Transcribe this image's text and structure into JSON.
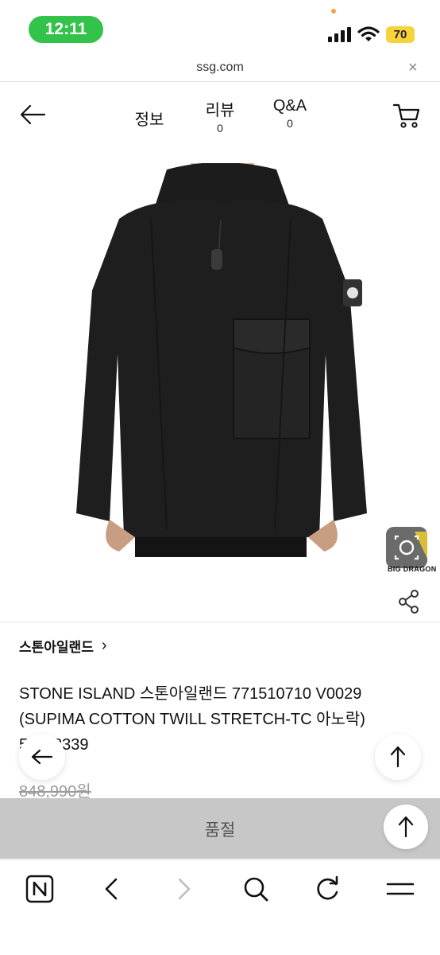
{
  "status_bar": {
    "time": "12:11",
    "battery": "70"
  },
  "browser": {
    "url": "ssg.com",
    "close_glyph": "×"
  },
  "header": {
    "tabs": [
      {
        "label": "정보"
      },
      {
        "label": "리뷰",
        "count": "0"
      },
      {
        "label": "Q&A",
        "count": "0"
      }
    ]
  },
  "product": {
    "brand": "스톤아일랜드",
    "brand_chevron": "›",
    "title": "STONE ISLAND 스톤아일랜드 771510710 V0029 (SUPIMA COTTON TWILL STRETCH-TC 아노락) 53118339",
    "original_price": "848,990원",
    "watermark": "BIG DRAGON",
    "image_subject": "black hooded anorak jacket with chest pocket and sleeve badge"
  },
  "soldout": {
    "label": "품절"
  },
  "icons": {
    "back": "back-arrow-icon",
    "cart": "cart-icon",
    "share": "share-icon",
    "lens": "lens-search-icon",
    "toolbar": [
      "naver-home-icon",
      "nav-back-icon",
      "nav-forward-icon",
      "search-icon",
      "refresh-icon",
      "menu-icon"
    ]
  },
  "colors": {
    "status_pill": "#33c34a",
    "battery": "#f7d23a",
    "soldout_bar": "#c7c7c7"
  }
}
